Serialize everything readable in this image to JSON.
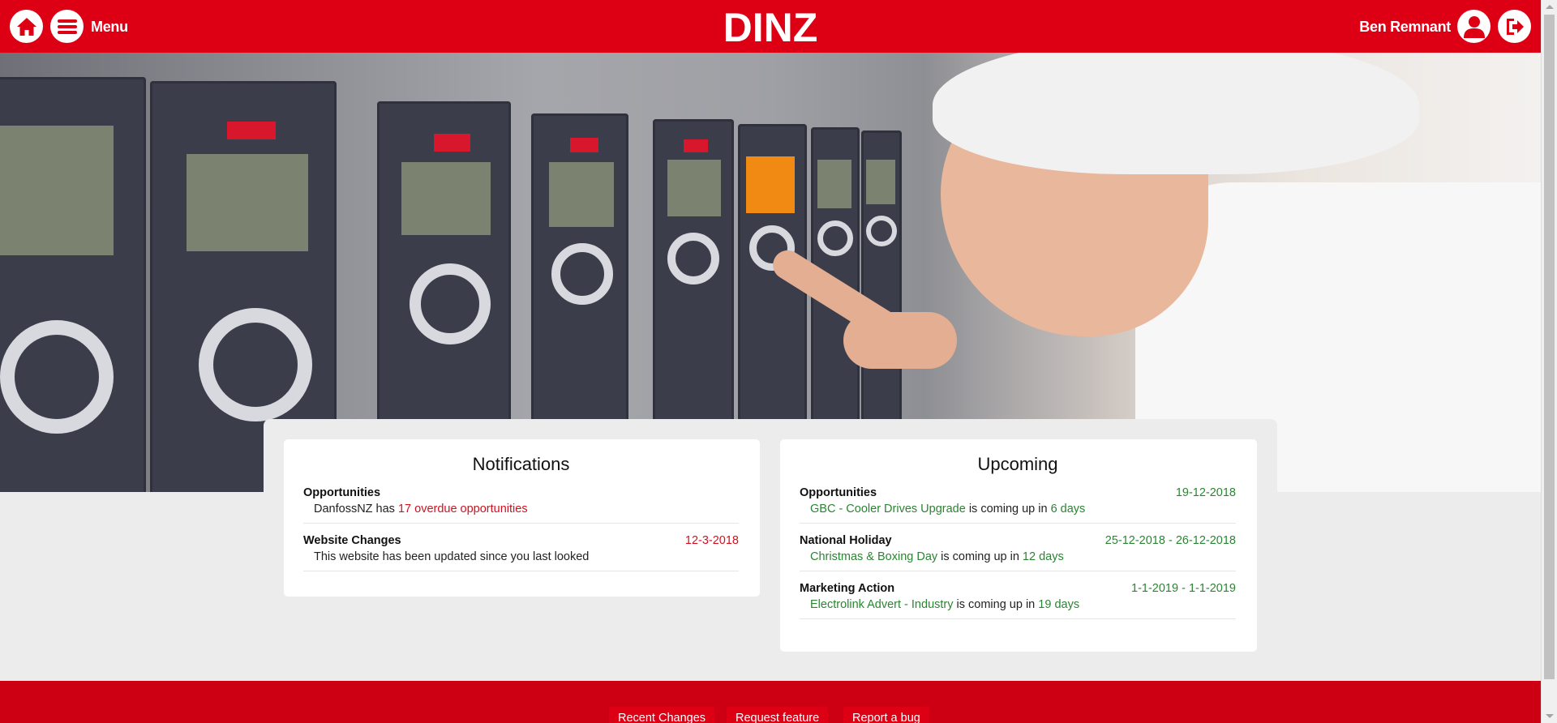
{
  "header": {
    "brand": "DINZ",
    "menu_label": "Menu",
    "user_name": "Ben Remnant",
    "icons": {
      "home": "home-icon",
      "menu": "hamburger-menu-icon",
      "user": "user-account-icon",
      "logout": "sign-out-icon"
    },
    "accent_color": "#dd0014"
  },
  "notifications": {
    "title": "Notifications",
    "items": [
      {
        "title": "Opportunities",
        "date": "",
        "body_prefix": "DanfossNZ has ",
        "link_text": "17 overdue opportunities",
        "body_suffix": ""
      },
      {
        "title": "Website Changes",
        "date": "12-3-2018",
        "body_prefix": "This website has been updated since you last looked",
        "link_text": "",
        "body_suffix": ""
      }
    ]
  },
  "upcoming": {
    "title": "Upcoming",
    "items": [
      {
        "title": "Opportunities",
        "date": "19-12-2018",
        "link_text": "GBC - Cooler Drives Upgrade",
        "middle": " is coming up in ",
        "days": "6 days"
      },
      {
        "title": "National Holiday",
        "date": "25-12-2018 - 26-12-2018",
        "link_text": "Christmas & Boxing Day",
        "middle": " is coming up in ",
        "days": "12 days"
      },
      {
        "title": "Marketing Action",
        "date": "1-1-2019 - 1-1-2019",
        "link_text": "Electrolink Advert - Industry",
        "middle": " is coming up in ",
        "days": "19 days"
      }
    ]
  },
  "footer": {
    "buttons": [
      "Recent Changes",
      "Request feature",
      "Report a bug"
    ]
  },
  "colors": {
    "overdue_red": "#d0121f",
    "upcoming_green": "#2a8532",
    "footer_red": "#cc0012"
  }
}
